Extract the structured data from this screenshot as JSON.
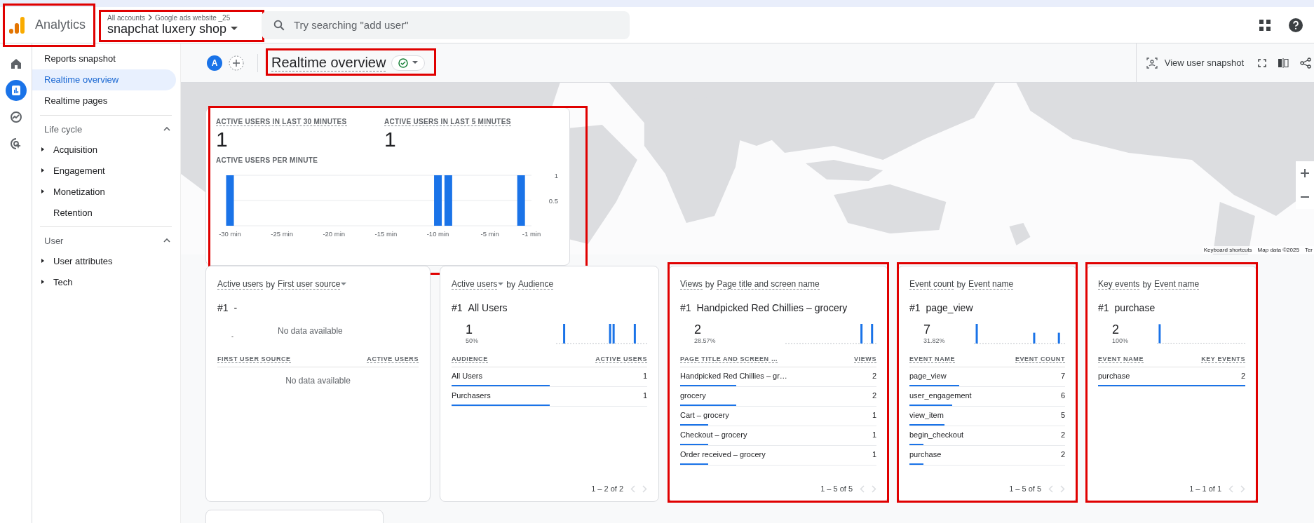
{
  "header": {
    "product": "Analytics",
    "logo_highlighted": true,
    "breadcrumb": [
      "All accounts",
      "Google ads website _25"
    ],
    "property": "snapchat luxery shop",
    "property_highlighted": true,
    "search_placeholder": "Try searching \"add user\""
  },
  "rail": [
    {
      "kind": "home",
      "selected": false
    },
    {
      "kind": "reports",
      "selected": true
    },
    {
      "kind": "explore",
      "selected": false
    },
    {
      "kind": "advertising",
      "selected": false
    }
  ],
  "sidebar": {
    "items": [
      {
        "label": "Reports snapshot",
        "selected": false
      },
      {
        "label": "Realtime overview",
        "selected": true
      },
      {
        "label": "Realtime pages",
        "selected": false
      }
    ],
    "sections": [
      {
        "label": "Life cycle",
        "expanded": true,
        "children": [
          {
            "label": "Acquisition",
            "expandable": true
          },
          {
            "label": "Engagement",
            "expandable": true
          },
          {
            "label": "Monetization",
            "expandable": true
          },
          {
            "label": "Retention",
            "expandable": false
          }
        ]
      },
      {
        "label": "User",
        "expanded": true,
        "children": [
          {
            "label": "User attributes",
            "expandable": true
          },
          {
            "label": "Tech",
            "expandable": true
          }
        ]
      }
    ]
  },
  "toolbar": {
    "avatar": "A",
    "title": "Realtime overview",
    "title_highlighted": true,
    "status_ok": true,
    "snapshot_label": "View user snapshot"
  },
  "map": {
    "kind": "picture",
    "footer": [
      "Keyboard shortcuts",
      "Map data ©2025",
      "Ter"
    ]
  },
  "summary": {
    "highlighted": true,
    "metrics": [
      {
        "label": "ACTIVE USERS IN LAST 30 MINUTES",
        "value": "1"
      },
      {
        "label": "ACTIVE USERS IN LAST 5 MINUTES",
        "value": "1"
      }
    ],
    "chart_data": {
      "type": "bar",
      "title": "ACTIVE USERS PER MINUTE",
      "x": [
        -30,
        -29,
        -28,
        -27,
        -26,
        -25,
        -24,
        -23,
        -22,
        -21,
        -20,
        -19,
        -18,
        -17,
        -16,
        -15,
        -14,
        -13,
        -12,
        -11,
        -10,
        -9,
        -8,
        -7,
        -6,
        -5,
        -4,
        -3,
        -2,
        -1
      ],
      "values": [
        1,
        0,
        0,
        0,
        0,
        0,
        0,
        0,
        0,
        0,
        0,
        0,
        0,
        0,
        0,
        0,
        0,
        0,
        0,
        0,
        1,
        1,
        0,
        0,
        0,
        0,
        0,
        0,
        1,
        0
      ],
      "xticks": [
        {
          "value": -30,
          "label": "-30 min"
        },
        {
          "value": -25,
          "label": "-25 min"
        },
        {
          "value": -20,
          "label": "-20 min"
        },
        {
          "value": -15,
          "label": "-15 min"
        },
        {
          "value": -10,
          "label": "-10 min"
        },
        {
          "value": -5,
          "label": "-5 min"
        },
        {
          "value": -1,
          "label": "-1 min"
        }
      ],
      "yticks": [
        0.5,
        1
      ],
      "xlim": [
        -30,
        -1
      ],
      "ylim": [
        0,
        1
      ]
    }
  },
  "cards": [
    {
      "metric": "Active users",
      "metric_dropdown": false,
      "by": "by",
      "dimension": "First user source",
      "dimension_dropdown": true,
      "highlighted": false,
      "rank": "#1",
      "top_name": "-",
      "top_value": "-",
      "top_note": "No data available",
      "columns": [
        "FIRST USER SOURCE",
        "ACTIVE USERS"
      ],
      "empty_text": "No data available"
    },
    {
      "metric": "Active users",
      "metric_dropdown": true,
      "by": "by",
      "dimension": "Audience",
      "dimension_dropdown": false,
      "highlighted": false,
      "rank": "#1",
      "top_name": "All Users",
      "top_value": "1",
      "top_percent": "50%",
      "columns": [
        "AUDIENCE",
        "ACTIVE USERS"
      ],
      "rows": [
        {
          "name": "All Users",
          "value": "1",
          "level": 0.5
        },
        {
          "name": "Purchasers",
          "value": "1",
          "level": 0.5
        }
      ],
      "pager": "1 – 2 of 2"
    },
    {
      "metric": "Views",
      "metric_dropdown": false,
      "by": "by",
      "dimension": "Page title and screen name",
      "dimension_dropdown": false,
      "highlighted": true,
      "rank": "#1",
      "top_name": "Handpicked Red Chillies – grocery",
      "top_value": "2",
      "top_percent": "28.57%",
      "columns": [
        "PAGE TITLE AND SCREEN …",
        "VIEWS"
      ],
      "rows": [
        {
          "name": "Handpicked Red Chillies – gr…",
          "value": "2",
          "level": 0.2857
        },
        {
          "name": "grocery",
          "value": "2",
          "level": 0.2857
        },
        {
          "name": "Cart – grocery",
          "value": "1",
          "level": 0.1429
        },
        {
          "name": "Checkout – grocery",
          "value": "1",
          "level": 0.1429
        },
        {
          "name": "Order received – grocery",
          "value": "1",
          "level": 0.1429
        }
      ],
      "pager": "1 – 5 of 5"
    },
    {
      "metric": "Event count",
      "metric_dropdown": false,
      "by": "by",
      "dimension": "Event name",
      "dimension_dropdown": false,
      "highlighted": true,
      "rank": "#1",
      "top_name": "page_view",
      "top_value": "7",
      "top_percent": "31.82%",
      "columns": [
        "EVENT NAME",
        "EVENT COUNT"
      ],
      "rows": [
        {
          "name": "page_view",
          "value": "7",
          "level": 0.3182
        },
        {
          "name": "user_engagement",
          "value": "6",
          "level": 0.2727
        },
        {
          "name": "view_item",
          "value": "5",
          "level": 0.2273
        },
        {
          "name": "begin_checkout",
          "value": "2",
          "level": 0.0909
        },
        {
          "name": "purchase",
          "value": "2",
          "level": 0.0909
        }
      ],
      "pager": "1 – 5 of 5"
    },
    {
      "metric": "Key events",
      "metric_dropdown": false,
      "by": "by",
      "dimension": "Event name",
      "dimension_dropdown": false,
      "highlighted": true,
      "rank": "#1",
      "top_name": "purchase",
      "top_value": "2",
      "top_percent": "100%",
      "columns": [
        "EVENT NAME",
        "KEY EVENTS"
      ],
      "rows": [
        {
          "name": "purchase",
          "value": "2",
          "level": 1
        }
      ],
      "pager": "1 – 1 of 1"
    }
  ]
}
